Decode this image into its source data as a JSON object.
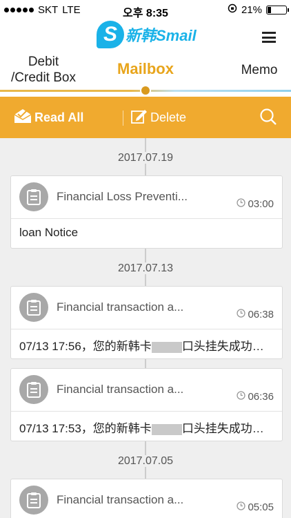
{
  "status_bar": {
    "carrier": "SKT",
    "network": "LTE",
    "time": "오후 8:35",
    "battery": "21%"
  },
  "header": {
    "logo_mark": "S",
    "logo_text": "新韩Smail"
  },
  "tabs": {
    "debit_line1": "Debit",
    "debit_line2": "/Credit Box",
    "mailbox": "Mailbox",
    "memo": "Memo"
  },
  "actions": {
    "read_all": "Read All",
    "delete": "Delete"
  },
  "colors": {
    "accent": "#f0aa2f",
    "active_tab": "#e8a51c",
    "brand": "#1ab2e8"
  },
  "messages": [
    {
      "date": "2017.07.19",
      "title": "Financial Loss Preventi...",
      "time": "03:00",
      "body": "loan Notice",
      "body_suffix": ""
    },
    {
      "date": "2017.07.13",
      "title": "Financial transaction a...",
      "time": "06:38",
      "body": "07/13 17:56，您的新韩卡",
      "body_suffix": "口头挂失成功…"
    },
    {
      "date": "",
      "title": "Financial transaction a...",
      "time": "06:36",
      "body": "07/13 17:53，您的新韩卡",
      "body_suffix": "口头挂失成功…"
    },
    {
      "date": "2017.07.05",
      "title": "Financial transaction a...",
      "time": "05:05",
      "body": "",
      "body_suffix": ""
    }
  ]
}
